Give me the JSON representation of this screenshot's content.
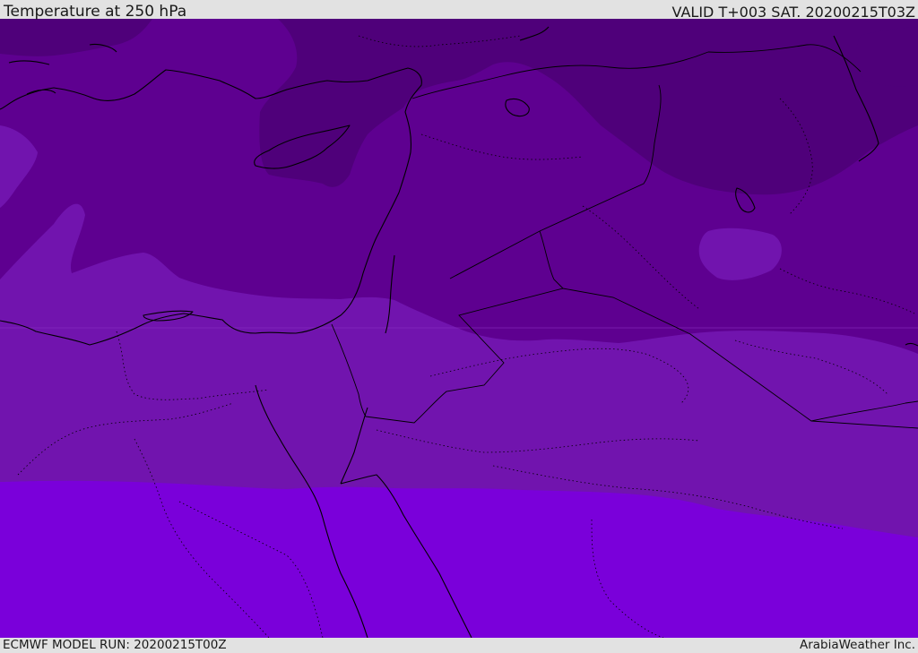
{
  "header": {
    "title": "Temperature at 250 hPa",
    "valid_time": "VALID T+003 SAT. 20200215T03Z"
  },
  "footer": {
    "model_run": "ECMWF MODEL RUN: 20200215T00Z",
    "credit": "ArabiaWeather Inc."
  },
  "map": {
    "colors": {
      "band_darkest": "#4f007a",
      "band_dark": "#5e0090",
      "band_mid": "#7114ae",
      "band_bright": "#7a00da",
      "coast": "#000000"
    }
  }
}
